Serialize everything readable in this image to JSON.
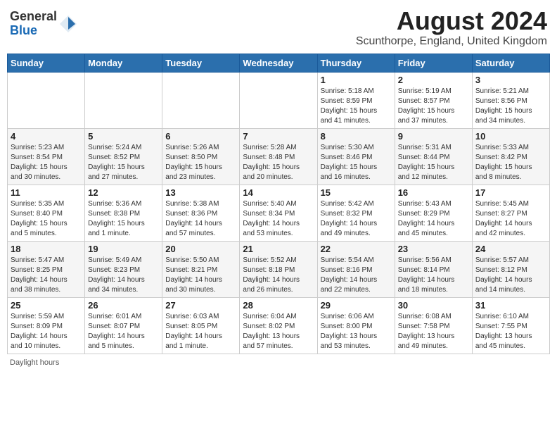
{
  "header": {
    "logo_general": "General",
    "logo_blue": "Blue",
    "title": "August 2024",
    "location": "Scunthorpe, England, United Kingdom"
  },
  "days_of_week": [
    "Sunday",
    "Monday",
    "Tuesday",
    "Wednesday",
    "Thursday",
    "Friday",
    "Saturday"
  ],
  "weeks": [
    [
      {
        "day": "",
        "info": ""
      },
      {
        "day": "",
        "info": ""
      },
      {
        "day": "",
        "info": ""
      },
      {
        "day": "",
        "info": ""
      },
      {
        "day": "1",
        "info": "Sunrise: 5:18 AM\nSunset: 8:59 PM\nDaylight: 15 hours\nand 41 minutes."
      },
      {
        "day": "2",
        "info": "Sunrise: 5:19 AM\nSunset: 8:57 PM\nDaylight: 15 hours\nand 37 minutes."
      },
      {
        "day": "3",
        "info": "Sunrise: 5:21 AM\nSunset: 8:56 PM\nDaylight: 15 hours\nand 34 minutes."
      }
    ],
    [
      {
        "day": "4",
        "info": "Sunrise: 5:23 AM\nSunset: 8:54 PM\nDaylight: 15 hours\nand 30 minutes."
      },
      {
        "day": "5",
        "info": "Sunrise: 5:24 AM\nSunset: 8:52 PM\nDaylight: 15 hours\nand 27 minutes."
      },
      {
        "day": "6",
        "info": "Sunrise: 5:26 AM\nSunset: 8:50 PM\nDaylight: 15 hours\nand 23 minutes."
      },
      {
        "day": "7",
        "info": "Sunrise: 5:28 AM\nSunset: 8:48 PM\nDaylight: 15 hours\nand 20 minutes."
      },
      {
        "day": "8",
        "info": "Sunrise: 5:30 AM\nSunset: 8:46 PM\nDaylight: 15 hours\nand 16 minutes."
      },
      {
        "day": "9",
        "info": "Sunrise: 5:31 AM\nSunset: 8:44 PM\nDaylight: 15 hours\nand 12 minutes."
      },
      {
        "day": "10",
        "info": "Sunrise: 5:33 AM\nSunset: 8:42 PM\nDaylight: 15 hours\nand 8 minutes."
      }
    ],
    [
      {
        "day": "11",
        "info": "Sunrise: 5:35 AM\nSunset: 8:40 PM\nDaylight: 15 hours\nand 5 minutes."
      },
      {
        "day": "12",
        "info": "Sunrise: 5:36 AM\nSunset: 8:38 PM\nDaylight: 15 hours\nand 1 minute."
      },
      {
        "day": "13",
        "info": "Sunrise: 5:38 AM\nSunset: 8:36 PM\nDaylight: 14 hours\nand 57 minutes."
      },
      {
        "day": "14",
        "info": "Sunrise: 5:40 AM\nSunset: 8:34 PM\nDaylight: 14 hours\nand 53 minutes."
      },
      {
        "day": "15",
        "info": "Sunrise: 5:42 AM\nSunset: 8:32 PM\nDaylight: 14 hours\nand 49 minutes."
      },
      {
        "day": "16",
        "info": "Sunrise: 5:43 AM\nSunset: 8:29 PM\nDaylight: 14 hours\nand 45 minutes."
      },
      {
        "day": "17",
        "info": "Sunrise: 5:45 AM\nSunset: 8:27 PM\nDaylight: 14 hours\nand 42 minutes."
      }
    ],
    [
      {
        "day": "18",
        "info": "Sunrise: 5:47 AM\nSunset: 8:25 PM\nDaylight: 14 hours\nand 38 minutes."
      },
      {
        "day": "19",
        "info": "Sunrise: 5:49 AM\nSunset: 8:23 PM\nDaylight: 14 hours\nand 34 minutes."
      },
      {
        "day": "20",
        "info": "Sunrise: 5:50 AM\nSunset: 8:21 PM\nDaylight: 14 hours\nand 30 minutes."
      },
      {
        "day": "21",
        "info": "Sunrise: 5:52 AM\nSunset: 8:18 PM\nDaylight: 14 hours\nand 26 minutes."
      },
      {
        "day": "22",
        "info": "Sunrise: 5:54 AM\nSunset: 8:16 PM\nDaylight: 14 hours\nand 22 minutes."
      },
      {
        "day": "23",
        "info": "Sunrise: 5:56 AM\nSunset: 8:14 PM\nDaylight: 14 hours\nand 18 minutes."
      },
      {
        "day": "24",
        "info": "Sunrise: 5:57 AM\nSunset: 8:12 PM\nDaylight: 14 hours\nand 14 minutes."
      }
    ],
    [
      {
        "day": "25",
        "info": "Sunrise: 5:59 AM\nSunset: 8:09 PM\nDaylight: 14 hours\nand 10 minutes."
      },
      {
        "day": "26",
        "info": "Sunrise: 6:01 AM\nSunset: 8:07 PM\nDaylight: 14 hours\nand 5 minutes."
      },
      {
        "day": "27",
        "info": "Sunrise: 6:03 AM\nSunset: 8:05 PM\nDaylight: 14 hours\nand 1 minute."
      },
      {
        "day": "28",
        "info": "Sunrise: 6:04 AM\nSunset: 8:02 PM\nDaylight: 13 hours\nand 57 minutes."
      },
      {
        "day": "29",
        "info": "Sunrise: 6:06 AM\nSunset: 8:00 PM\nDaylight: 13 hours\nand 53 minutes."
      },
      {
        "day": "30",
        "info": "Sunrise: 6:08 AM\nSunset: 7:58 PM\nDaylight: 13 hours\nand 49 minutes."
      },
      {
        "day": "31",
        "info": "Sunrise: 6:10 AM\nSunset: 7:55 PM\nDaylight: 13 hours\nand 45 minutes."
      }
    ]
  ],
  "footer": {
    "note": "Daylight hours"
  }
}
